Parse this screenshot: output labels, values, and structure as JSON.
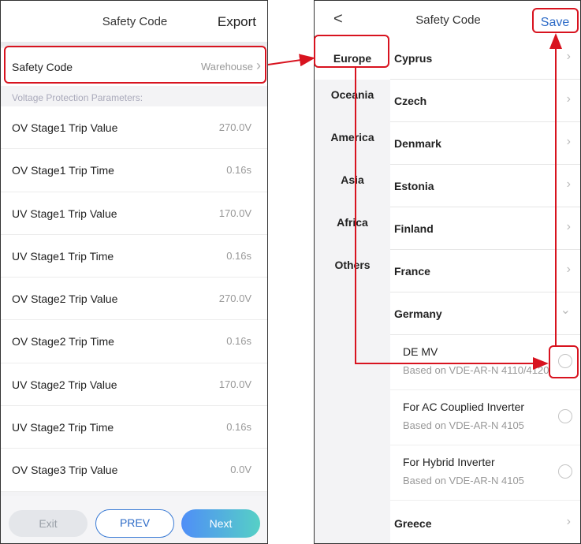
{
  "left_screen": {
    "header": {
      "title": "Safety Code",
      "export_label": "Export"
    },
    "safety_code": {
      "label": "Safety Code",
      "value": "Warehouse"
    },
    "section_header": "Voltage Protection Parameters:",
    "params": [
      {
        "label": "OV Stage1 Trip Value",
        "value": "270.0V"
      },
      {
        "label": "OV Stage1 Trip Time",
        "value": "0.16s"
      },
      {
        "label": "UV Stage1 Trip Value",
        "value": "170.0V"
      },
      {
        "label": "UV Stage1 Trip Time",
        "value": "0.16s"
      },
      {
        "label": "OV Stage2 Trip Value",
        "value": "270.0V"
      },
      {
        "label": "OV Stage2 Trip Time",
        "value": "0.16s"
      },
      {
        "label": "UV Stage2 Trip Value",
        "value": "170.0V"
      },
      {
        "label": "UV Stage2 Trip Time",
        "value": "0.16s"
      },
      {
        "label": "OV Stage3 Trip Value",
        "value": "0.0V"
      }
    ],
    "footer": {
      "exit_label": "Exit",
      "prev_label": "PREV",
      "next_label": "Next"
    }
  },
  "right_screen": {
    "header": {
      "back_icon": "<",
      "title": "Safety Code",
      "save_label": "Save"
    },
    "regions": [
      "Europe",
      "Oceania",
      "America",
      "Asia",
      "Africa",
      "Others"
    ],
    "countries": {
      "cyprus": "Cyprus",
      "czech": "Czech",
      "denmark": "Denmark",
      "estonia": "Estonia",
      "finland": "Finland",
      "france": "France",
      "germany": "Germany",
      "greece": "Greece"
    },
    "germany_options": [
      {
        "name": "DE MV",
        "desc": "Based on VDE-AR-N  4110/4120"
      },
      {
        "name": "For AC Couplied Inverter",
        "desc": "Based on VDE-AR-N  4105"
      },
      {
        "name": "For Hybrid Inverter",
        "desc": "Based on VDE-AR-N  4105"
      }
    ]
  },
  "colors": {
    "annotation_red": "#d8131f",
    "accent_blue": "#2d6bc7",
    "next_gradient_start": "#4f8ef7",
    "next_gradient_end": "#56d0c6"
  },
  "icons": {
    "chevron_right": "›",
    "chevron_down": "⌄"
  }
}
